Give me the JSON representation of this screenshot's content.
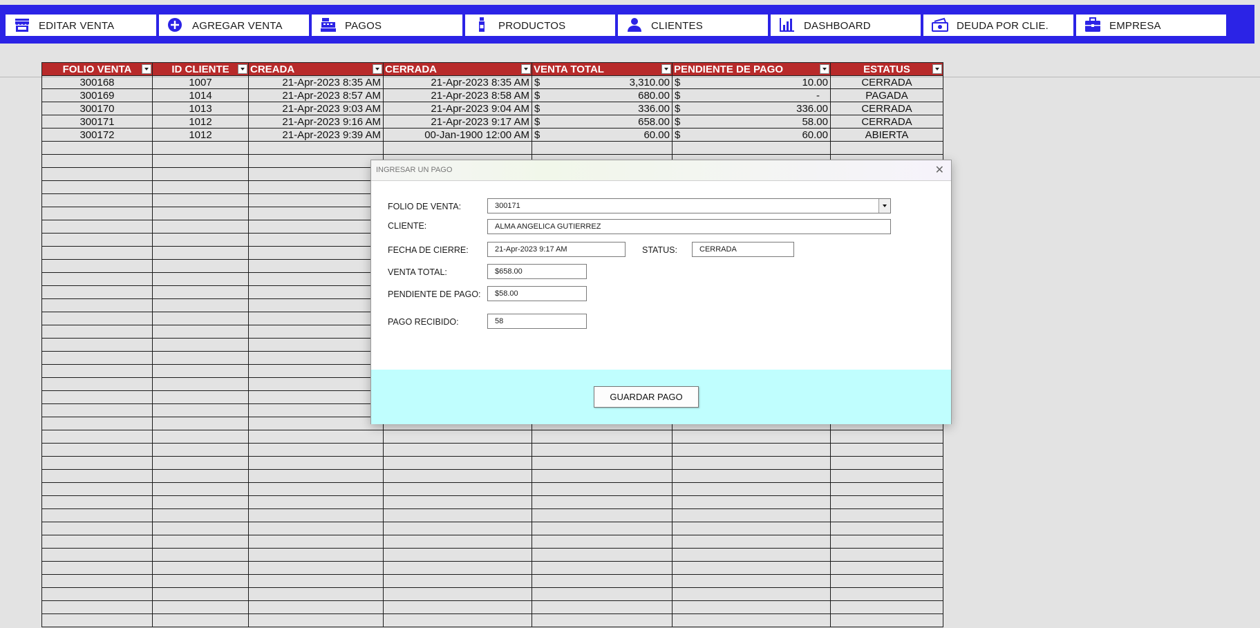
{
  "nav": [
    {
      "label": "EDITAR VENTA",
      "icon": "store-icon"
    },
    {
      "label": "AGREGAR VENTA",
      "icon": "plus-circle-icon"
    },
    {
      "label": "PAGOS",
      "icon": "cash-register-icon"
    },
    {
      "label": "PRODUCTOS",
      "icon": "bottle-icon"
    },
    {
      "label": "CLIENTES",
      "icon": "user-icon"
    },
    {
      "label": "DASHBOARD",
      "icon": "bar-chart-icon"
    },
    {
      "label": "DEUDA POR CLIE.",
      "icon": "money-bill-icon"
    },
    {
      "label": "EMPRESA",
      "icon": "briefcase-icon"
    }
  ],
  "table": {
    "headers": [
      "FOLIO VENTA",
      "ID CLIENTE",
      "CREADA",
      "CERRADA",
      "VENTA TOTAL",
      "PENDIENTE DE PAGO",
      "ESTATUS"
    ],
    "currency_symbol": "$",
    "rows": [
      {
        "folio": "300168",
        "cliente": "1007",
        "creada": "21-Apr-2023 8:35 AM",
        "cerrada": "21-Apr-2023 8:35 AM",
        "total": "3,310.00",
        "pendiente": "10.00",
        "estatus": "CERRADA"
      },
      {
        "folio": "300169",
        "cliente": "1014",
        "creada": "21-Apr-2023 8:57 AM",
        "cerrada": "21-Apr-2023 8:58 AM",
        "total": "680.00",
        "pendiente": "-",
        "estatus": "PAGADA"
      },
      {
        "folio": "300170",
        "cliente": "1013",
        "creada": "21-Apr-2023 9:03 AM",
        "cerrada": "21-Apr-2023 9:04 AM",
        "total": "336.00",
        "pendiente": "336.00",
        "estatus": "CERRADA"
      },
      {
        "folio": "300171",
        "cliente": "1012",
        "creada": "21-Apr-2023 9:16 AM",
        "cerrada": "21-Apr-2023 9:17 AM",
        "total": "658.00",
        "pendiente": "58.00",
        "estatus": "CERRADA"
      },
      {
        "folio": "300172",
        "cliente": "1012",
        "creada": "21-Apr-2023 9:39 AM",
        "cerrada": "00-Jan-1900 12:00 AM",
        "total": "60.00",
        "pendiente": "60.00",
        "estatus": "ABIERTA"
      }
    ]
  },
  "dialog": {
    "title": "INGRESAR UN PAGO",
    "folio_label": "FOLIO DE VENTA:",
    "folio_value": "300171",
    "cliente_label": "CLIENTE:",
    "cliente_value": "ALMA ANGELICA GUTIERREZ",
    "fecha_label": "FECHA DE CIERRE:",
    "fecha_value": "21-Apr-2023 9:17 AM",
    "status_label": "STATUS:",
    "status_value": "CERRADA",
    "total_label": "VENTA TOTAL:",
    "total_value": "$658.00",
    "pendiente_label": "PENDIENTE DE PAGO:",
    "pendiente_value": "$58.00",
    "pago_label": "PAGO RECIBIDO:",
    "pago_value": "58",
    "save_label": "GUARDAR PAGO",
    "close_glyph": "✕"
  },
  "colors": {
    "nav": "#2b23e6",
    "header": "#b82a2a",
    "dialog_footer": "#c0fefe"
  }
}
